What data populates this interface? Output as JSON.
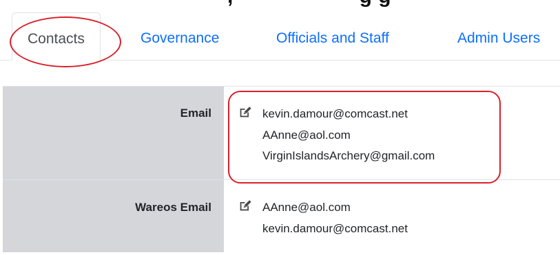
{
  "header": {
    "cut_text": ", · · · · · · · · ·  g g    ·"
  },
  "tabs": [
    {
      "label": "Contacts",
      "active": true
    },
    {
      "label": "Governance",
      "active": false
    },
    {
      "label": "Officials and Staff",
      "active": false
    },
    {
      "label": "Admin Users",
      "active": false
    }
  ],
  "rows": [
    {
      "label": "Email",
      "icon": "edit-icon",
      "values": [
        "kevin.damour@comcast.net",
        "AAnne@aol.com",
        "VirginIslandsArchery@gmail.com"
      ]
    },
    {
      "label": "Wareos Email",
      "icon": "edit-icon",
      "values": [
        "AAnne@aol.com",
        "kevin.damour@comcast.net"
      ]
    }
  ],
  "colors": {
    "link": "#0d6efd",
    "label_bg": "#d4d6da",
    "annotation": "#d8202a",
    "active_tab_text": "#495057"
  }
}
